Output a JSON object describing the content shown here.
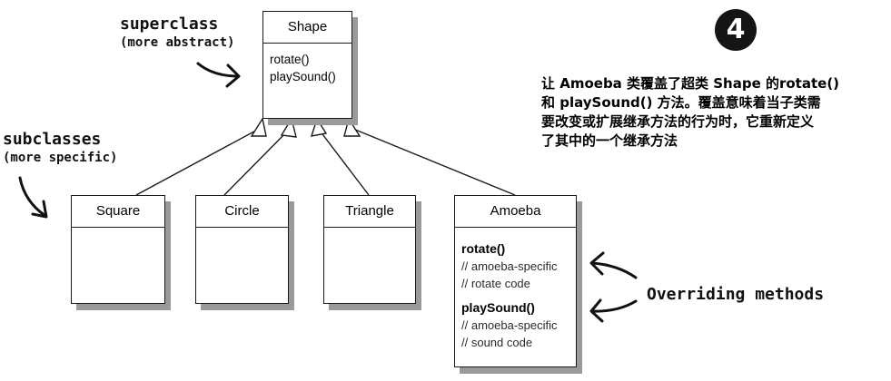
{
  "annotations": {
    "superclass_title": "superclass",
    "superclass_sub": "(more abstract)",
    "subclasses_title": "subclasses",
    "subclasses_sub": "(more specific)",
    "overriding": "Overriding methods"
  },
  "superclass": {
    "name": "Shape",
    "methods": [
      "rotate()",
      "playSound()"
    ]
  },
  "subclasses": [
    {
      "name": "Square"
    },
    {
      "name": "Circle"
    },
    {
      "name": "Triangle"
    },
    {
      "name": "Amoeba",
      "rotate": "rotate()",
      "rotate_comment_1": "// amoeba-specific",
      "rotate_comment_2": "// rotate code",
      "play": "playSound()",
      "play_comment_1": "// amoeba-specific",
      "play_comment_2": "// sound code"
    }
  ],
  "step_badge": "4",
  "description": [
    "让 Amoeba 类覆盖了超类 Shape 的rotate()",
    "和 playSound() 方法。覆盖意味着当子类需",
    "要改变或扩展继承方法的行为时，它重新定义",
    "了其中的一个继承方法"
  ],
  "colors": {
    "line": "#1a1a1a",
    "shadow": "#9a9a9a",
    "badge": "#151515"
  }
}
